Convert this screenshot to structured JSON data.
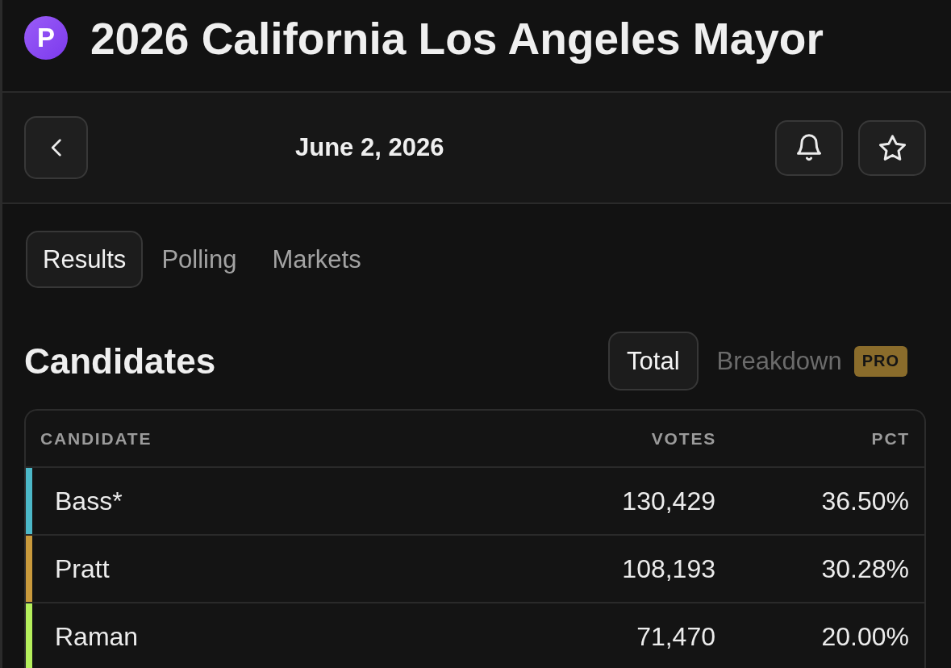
{
  "header": {
    "logo_letter": "P",
    "title": "2026 California Los Angeles Mayor"
  },
  "date_bar": {
    "date": "June 2, 2026"
  },
  "tabs": [
    {
      "label": "Results",
      "selected": true
    },
    {
      "label": "Polling",
      "selected": false
    },
    {
      "label": "Markets",
      "selected": false
    }
  ],
  "candidates": {
    "title": "Candidates",
    "views": [
      {
        "label": "Total",
        "selected": true
      },
      {
        "label": "Breakdown",
        "selected": false,
        "badge": "PRO"
      }
    ],
    "table": {
      "columns": [
        "CANDIDATE",
        "VOTES",
        "PCT"
      ],
      "rows": [
        {
          "name": "Bass*",
          "votes": "130,429",
          "pct": "36.50%",
          "color": "#4cb8c8"
        },
        {
          "name": "Pratt",
          "votes": "108,193",
          "pct": "30.28%",
          "color": "#c99a3c"
        },
        {
          "name": "Raman",
          "votes": "71,470",
          "pct": "20.00%",
          "color": "#b5ef5c"
        }
      ]
    }
  }
}
